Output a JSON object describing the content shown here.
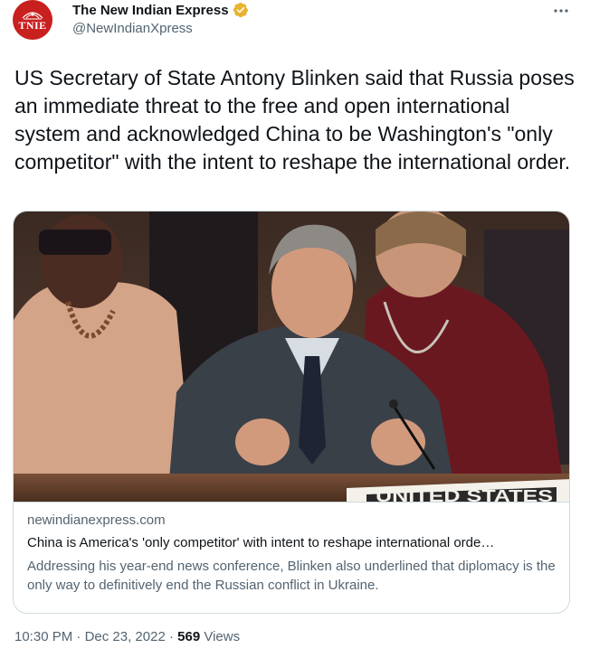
{
  "account": {
    "display_name": "The New Indian Express",
    "handle": "@NewIndianXpress",
    "avatar_text": "TNIE",
    "verified": true,
    "verified_color": "#e8b32e",
    "brand_color": "#c8201f"
  },
  "tweet": {
    "text": "US Secretary of State Antony Blinken said that Russia poses an immediate threat to the free and open international system and acknowledged China to be Washington's \"only competitor\" with the intent to reshape the international order."
  },
  "card": {
    "image_placard": "UNITED STATES",
    "domain": "newindianexpress.com",
    "title": "China is America's 'only competitor' with intent to reshape international orde…",
    "description": "Addressing his year-end news conference, Blinken also underlined that diplomacy is the only way to definitively end the Russian conflict in Ukraine."
  },
  "meta": {
    "time": "10:30 PM",
    "separator1": "·",
    "date": "Dec 23, 2022",
    "separator2": "·",
    "views_count": "569",
    "views_label": "Views"
  },
  "icons": {
    "more": "more-options-icon",
    "verified": "verified-badge-icon"
  }
}
